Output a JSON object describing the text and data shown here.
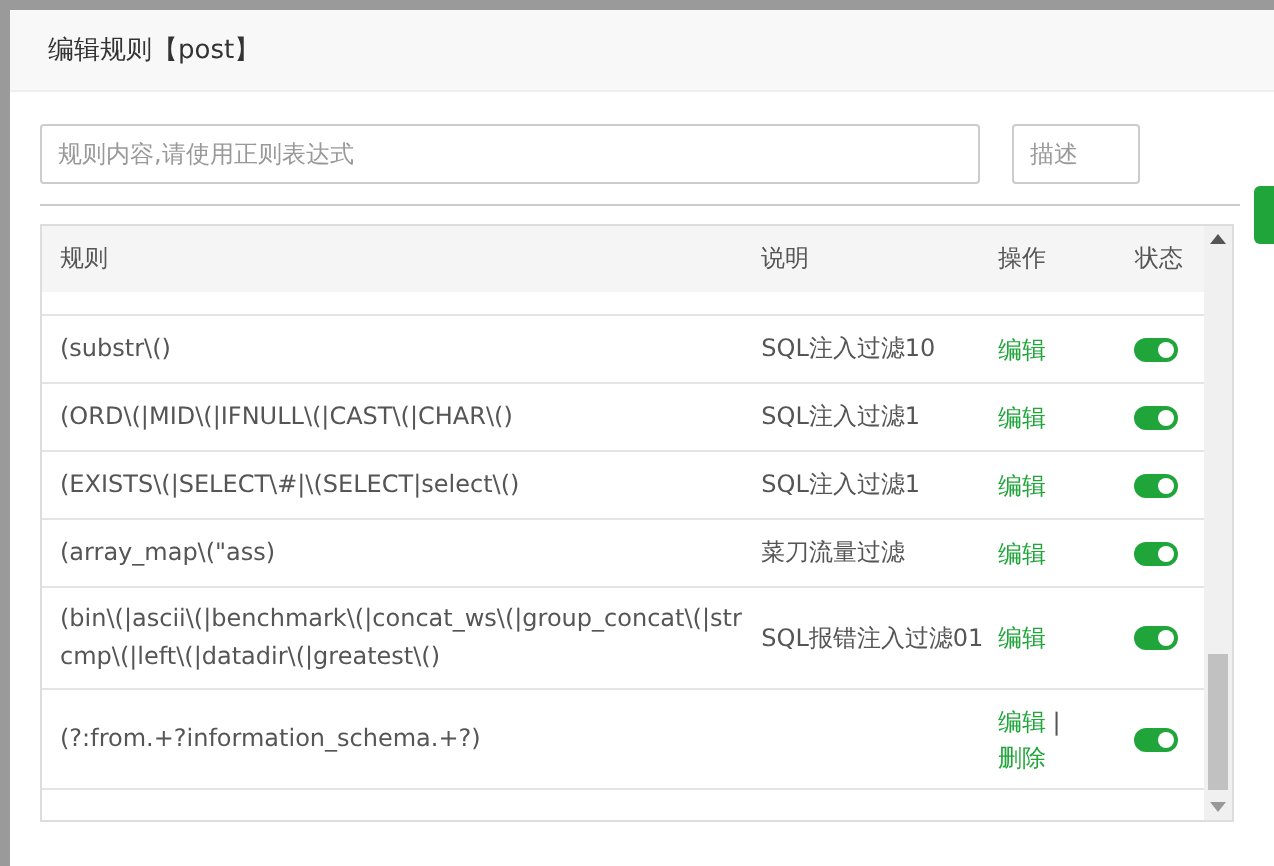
{
  "dialog": {
    "title": "编辑规则【post】"
  },
  "form": {
    "rule_placeholder": "规则内容,请使用正则表达式",
    "description_placeholder": "描述"
  },
  "table": {
    "columns": [
      "规则",
      "说明",
      "操作",
      "状态"
    ],
    "rows": [
      {
        "rule": "(substr\\()",
        "description": "SQL注入过滤10",
        "actions": [
          {
            "kind": "link",
            "label": "编辑"
          }
        ],
        "on": true
      },
      {
        "rule": "(ORD\\(|MID\\(|IFNULL\\(|CAST\\(|CHAR\\()",
        "description": "SQL注入过滤1",
        "actions": [
          {
            "kind": "link",
            "label": "编辑"
          }
        ],
        "on": true
      },
      {
        "rule": "(EXISTS\\(|SELECT\\#|\\(SELECT|select\\()",
        "description": "SQL注入过滤1",
        "actions": [
          {
            "kind": "link",
            "label": "编辑"
          }
        ],
        "on": true
      },
      {
        "rule": "(array_map\\(\"ass)",
        "description": "菜刀流量过滤",
        "actions": [
          {
            "kind": "link",
            "label": "编辑"
          }
        ],
        "on": true
      },
      {
        "rule": "(bin\\(|ascii\\(|benchmark\\(|concat_ws\\(|group_concat\\(|strcmp\\(|left\\(|datadir\\(|greatest\\()",
        "description": "SQL报错注入过滤01",
        "actions": [
          {
            "kind": "link",
            "label": "编辑"
          }
        ],
        "on": true
      },
      {
        "rule": "(?:from.+?information_schema.+?)",
        "description": "",
        "actions": [
          {
            "kind": "link",
            "label": "编辑"
          },
          {
            "kind": "separator",
            "label": "|"
          },
          {
            "kind": "link",
            "label": "删除"
          }
        ],
        "on": true
      }
    ]
  }
}
